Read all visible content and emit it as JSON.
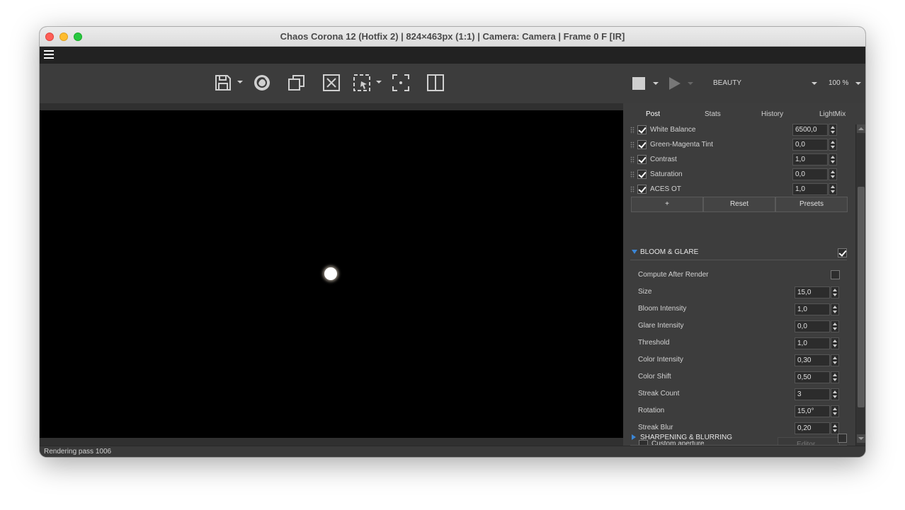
{
  "window": {
    "title": "Chaos Corona 12 (Hotfix 2) | 824×463px (1:1) | Camera: Camera | Frame 0 F [IR]"
  },
  "toolbar": {
    "icons": [
      "save-icon",
      "corona-render-icon",
      "copy-icon",
      "clear-icon",
      "region-select-icon",
      "focus-point-icon",
      "split-view-icon",
      "stop-icon",
      "play-icon"
    ],
    "render_element": "BEAUTY",
    "zoom": "100 %"
  },
  "status": {
    "text": "Rendering pass 1006"
  },
  "panel": {
    "tabs": [
      "Post",
      "Stats",
      "History",
      "LightMix"
    ],
    "active_tab": "Post",
    "operators": [
      {
        "label": "White Balance",
        "value": "6500,0",
        "checked": true
      },
      {
        "label": "Green-Magenta Tint",
        "value": "0,0",
        "checked": true
      },
      {
        "label": "Contrast",
        "value": "1,0",
        "checked": true
      },
      {
        "label": "Saturation",
        "value": "0,0",
        "checked": true
      },
      {
        "label": "ACES OT",
        "value": "1,0",
        "checked": true
      }
    ],
    "operator_buttons": {
      "add": "+",
      "reset": "Reset",
      "presets": "Presets"
    },
    "bloom_glare": {
      "header": "BLOOM & GLARE",
      "enabled": true,
      "compute_after_render_label": "Compute After Render",
      "compute_after_render": false,
      "params": [
        {
          "label": "Size",
          "value": "15,0"
        },
        {
          "label": "Bloom Intensity",
          "value": "1,0"
        },
        {
          "label": "Glare Intensity",
          "value": "0,0"
        },
        {
          "label": "Threshold",
          "value": "1,0"
        },
        {
          "label": "Color Intensity",
          "value": "0,30"
        },
        {
          "label": "Color Shift",
          "value": "0,50"
        },
        {
          "label": "Streak Count",
          "value": "3"
        },
        {
          "label": "Rotation",
          "value": "15,0°"
        },
        {
          "label": "Streak Blur",
          "value": "0,20"
        }
      ],
      "custom_aperture_label": "Custom aperture",
      "editor_label": "Editor..."
    },
    "sharpening": {
      "header": "SHARPENING & BLURRING",
      "enabled": false
    }
  },
  "colors": {
    "accent": "#3b86d6",
    "panel_bg": "#3d3d3d",
    "render_bg": "#000000"
  }
}
